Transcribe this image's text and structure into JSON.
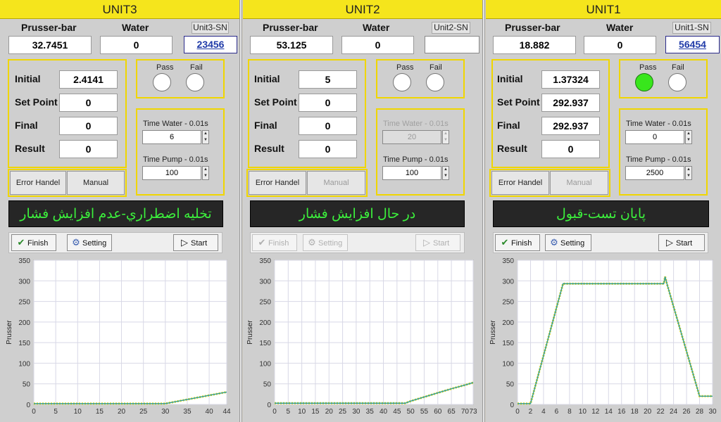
{
  "units": [
    {
      "key": "u3",
      "title": "UNIT3",
      "label_pressure": "Prusser-bar",
      "label_water": "Water",
      "sn_label": "Unit3-SN",
      "pressure": "32.7451",
      "water": "0",
      "sn": "23456",
      "initial_label": "Initial",
      "initial": "2.4141",
      "setpoint_label": "Set Point",
      "setpoint": "0",
      "final_label": "Final",
      "final": "0",
      "result_label": "Result",
      "result": "0",
      "pass_label": "Pass",
      "fail_label": "Fail",
      "pass_on": false,
      "time_water_label": "Time Water - 0.01s",
      "time_water": "6",
      "time_water_disabled": false,
      "time_pump_label": "Time Pump - 0.01s",
      "time_pump": "100",
      "error_btn": "Error Handel",
      "manual_btn": "Manual",
      "manual_disabled": false,
      "status": "تخلیه اضطراري-عدم افزايش فشار",
      "finish_btn": "Finish",
      "setting_btn": "Setting",
      "start_btn": "Start",
      "toolbar_disabled": false
    },
    {
      "key": "u2",
      "title": "UNIT2",
      "label_pressure": "Prusser-bar",
      "label_water": "Water",
      "sn_label": "Unit2-SN",
      "pressure": "53.125",
      "water": "0",
      "sn": "",
      "initial_label": "Initial",
      "initial": "5",
      "setpoint_label": "Set Point",
      "setpoint": "0",
      "final_label": "Final",
      "final": "0",
      "result_label": "Result",
      "result": "0",
      "pass_label": "Pass",
      "fail_label": "Fail",
      "pass_on": false,
      "time_water_label": "Time Water - 0.01s",
      "time_water": "20",
      "time_water_disabled": true,
      "time_pump_label": "Time Pump - 0.01s",
      "time_pump": "100",
      "error_btn": "Error Handel",
      "manual_btn": "Manual",
      "manual_disabled": true,
      "status": "در حال افزايش فشار",
      "finish_btn": "Finish",
      "setting_btn": "Setting",
      "start_btn": "Start",
      "toolbar_disabled": true
    },
    {
      "key": "u1",
      "title": "UNIT1",
      "label_pressure": "Prusser-bar",
      "label_water": "Water",
      "sn_label": "Unit1-SN",
      "pressure": "18.882",
      "water": "0",
      "sn": "56454",
      "initial_label": "Initial",
      "initial": "1.37324",
      "setpoint_label": "Set Point",
      "setpoint": "292.937",
      "final_label": "Final",
      "final": "292.937",
      "result_label": "Result",
      "result": "0",
      "pass_label": "Pass",
      "fail_label": "Fail",
      "pass_on": true,
      "time_water_label": "Time Water - 0.01s",
      "time_water": "0",
      "time_water_disabled": false,
      "time_pump_label": "Time Pump - 0.01s",
      "time_pump": "2500",
      "error_btn": "Error Handel",
      "manual_btn": "Manual",
      "manual_disabled": true,
      "status": "پایان تست-قبول",
      "finish_btn": "Finish",
      "setting_btn": "Setting",
      "start_btn": "Start",
      "toolbar_disabled": false
    }
  ],
  "colors": {
    "header": "#f5e51c",
    "box_border": "#f0d600",
    "status_text": "#3cf03c",
    "status_bg": "#262626",
    "led_on": "#38e61c",
    "series_line": "#2e9c9c",
    "series_marker": "#e8d800"
  },
  "chart_data": [
    {
      "type": "line",
      "ylabel": "Prusser",
      "ylim": [
        0,
        350
      ],
      "yticks": [
        0,
        50,
        100,
        150,
        200,
        250,
        300,
        350
      ],
      "xlim": [
        0,
        44
      ],
      "xticks": [
        0,
        5,
        10,
        15,
        20,
        25,
        30,
        35,
        40,
        44
      ],
      "series": [
        {
          "x": [
            0,
            5,
            10,
            15,
            20,
            25,
            30,
            31,
            33,
            36,
            40,
            44
          ],
          "y": [
            2,
            2,
            2,
            2,
            2,
            2,
            2,
            4,
            8,
            14,
            22,
            30
          ]
        }
      ]
    },
    {
      "type": "line",
      "ylabel": "Prusser",
      "ylim": [
        0,
        350
      ],
      "yticks": [
        0,
        50,
        100,
        150,
        200,
        250,
        300,
        350
      ],
      "xlim": [
        0,
        73
      ],
      "xticks": [
        0,
        5,
        10,
        15,
        20,
        25,
        30,
        35,
        40,
        45,
        50,
        55,
        60,
        65,
        70,
        73
      ],
      "series": [
        {
          "x": [
            0,
            10,
            20,
            30,
            40,
            48,
            50,
            55,
            60,
            65,
            70,
            73
          ],
          "y": [
            3,
            3,
            3,
            3,
            3,
            3,
            8,
            18,
            28,
            38,
            47,
            53
          ]
        }
      ]
    },
    {
      "type": "line",
      "ylabel": "Prusser",
      "ylim": [
        0,
        350
      ],
      "yticks": [
        0,
        50,
        100,
        150,
        200,
        250,
        300,
        350
      ],
      "xlim": [
        0,
        30
      ],
      "xticks": [
        0,
        2,
        4,
        6,
        8,
        10,
        12,
        14,
        16,
        18,
        20,
        22,
        24,
        26,
        28,
        30
      ],
      "series": [
        {
          "x": [
            0,
            1.5,
            2,
            7,
            10,
            15,
            20,
            22.5,
            22.7,
            23,
            28,
            30
          ],
          "y": [
            2,
            2,
            2,
            293,
            293,
            293,
            293,
            293,
            310,
            292,
            20,
            20
          ]
        }
      ]
    }
  ]
}
